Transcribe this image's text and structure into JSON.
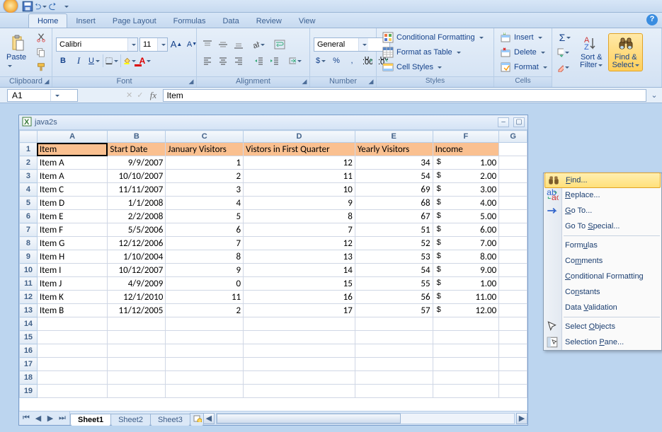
{
  "qat": {
    "save": "Save",
    "undo": "Undo",
    "redo": "Redo"
  },
  "tabs": {
    "home": "Home",
    "insert": "Insert",
    "page_layout": "Page Layout",
    "formulas": "Formulas",
    "data": "Data",
    "review": "Review",
    "view": "View"
  },
  "ribbon": {
    "clipboard": {
      "label": "Clipboard",
      "paste": "Paste"
    },
    "font": {
      "label": "Font",
      "font_value": "Calibri",
      "size_value": "11",
      "growfont": "A",
      "shrinkfont": "A",
      "bold": "B",
      "italic": "I",
      "underline": "U"
    },
    "alignment": {
      "label": "Alignment"
    },
    "number": {
      "label": "Number",
      "format_value": "General",
      "dollar": "$",
      "percent": "%",
      "comma": ","
    },
    "styles": {
      "label": "Styles",
      "cond": "Conditional Formatting",
      "table": "Format as Table",
      "cellstyles": "Cell Styles"
    },
    "cells": {
      "label": "Cells",
      "insert": "Insert",
      "delete": "Delete",
      "format": "Format"
    },
    "editing": {
      "sort": "Sort & Filter",
      "find": "Find & Select",
      "sigma": "Σ"
    }
  },
  "formula_bar": {
    "name_box": "A1",
    "fx": "fx",
    "formula": "Item"
  },
  "workbook": {
    "title": "java2s",
    "columns": [
      "A",
      "B",
      "C",
      "D",
      "E",
      "F",
      "G"
    ],
    "headers": [
      "Item",
      "Start Date",
      "January Visitors",
      "Vistors in First Quarter",
      "Yearly Visitors",
      "Income"
    ],
    "rows": [
      {
        "item": "Item A",
        "date": "9/9/2007",
        "jan": "1",
        "q1": "12",
        "yr": "34",
        "inc": "1.00"
      },
      {
        "item": "Item A",
        "date": "10/10/2007",
        "jan": "2",
        "q1": "11",
        "yr": "54",
        "inc": "2.00"
      },
      {
        "item": "Item C",
        "date": "11/11/2007",
        "jan": "3",
        "q1": "10",
        "yr": "69",
        "inc": "3.00"
      },
      {
        "item": "Item D",
        "date": "1/1/2008",
        "jan": "4",
        "q1": "9",
        "yr": "68",
        "inc": "4.00"
      },
      {
        "item": "Item E",
        "date": "2/2/2008",
        "jan": "5",
        "q1": "8",
        "yr": "67",
        "inc": "5.00"
      },
      {
        "item": "Item F",
        "date": "5/5/2006",
        "jan": "6",
        "q1": "7",
        "yr": "51",
        "inc": "6.00"
      },
      {
        "item": "Item G",
        "date": "12/12/2006",
        "jan": "7",
        "q1": "12",
        "yr": "52",
        "inc": "7.00"
      },
      {
        "item": "Item H",
        "date": "1/10/2004",
        "jan": "8",
        "q1": "13",
        "yr": "53",
        "inc": "8.00"
      },
      {
        "item": "Item I",
        "date": "10/12/2007",
        "jan": "9",
        "q1": "14",
        "yr": "54",
        "inc": "9.00"
      },
      {
        "item": "Item J",
        "date": "4/9/2009",
        "jan": "0",
        "q1": "15",
        "yr": "55",
        "inc": "1.00"
      },
      {
        "item": "Item K",
        "date": "12/1/2010",
        "jan": "11",
        "q1": "16",
        "yr": "56",
        "inc": "11.00"
      },
      {
        "item": "Item B",
        "date": "11/12/2005",
        "jan": "2",
        "q1": "17",
        "yr": "57",
        "inc": "12.00"
      }
    ],
    "currency_symbol": "$",
    "sheets": {
      "s1": "Sheet1",
      "s2": "Sheet2",
      "s3": "Sheet3"
    }
  },
  "find_menu": {
    "find": "Find...",
    "replace": "Replace...",
    "goto": "Go To...",
    "goto_special": "Go To Special...",
    "formulas": "Formulas",
    "comments": "Comments",
    "cond": "Conditional Formatting",
    "constants": "Constants",
    "validation": "Data Validation",
    "sel_objects": "Select Objects",
    "sel_pane": "Selection Pane..."
  }
}
